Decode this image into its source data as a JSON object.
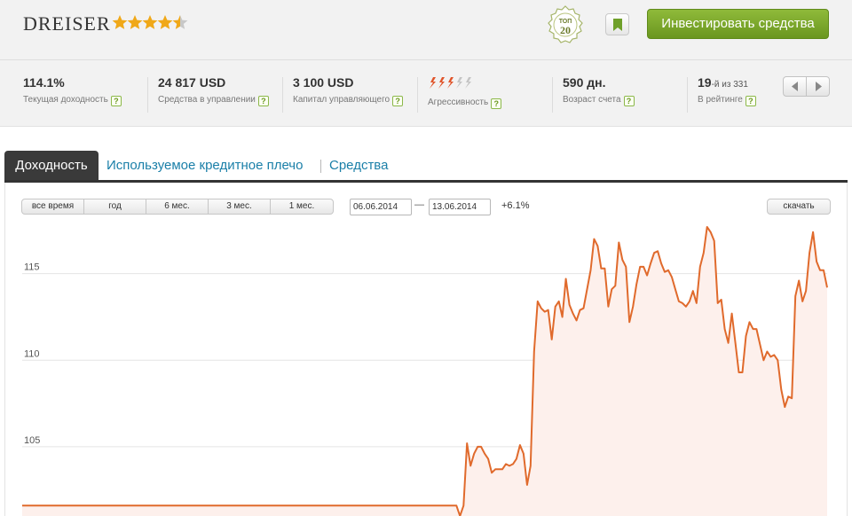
{
  "header": {
    "name": "DREISER",
    "rating_stars": 4.5,
    "badge_top": "ТОП",
    "badge_num": "20",
    "invest_label": "Инвестировать средства"
  },
  "stats": [
    {
      "value": "114.1%",
      "label": "Текущая доходность"
    },
    {
      "value": "24 817 USD",
      "label": "Средства в управлении"
    },
    {
      "value": "3 100 USD",
      "label": "Капитал управляющего"
    },
    {
      "value": "",
      "label": "Агрессивность",
      "aggression_level": 3,
      "aggression_max": 5
    },
    {
      "value": "590 дн.",
      "label": "Возраст счета"
    },
    {
      "value": "19",
      "value_suffix": "-й из 331",
      "label": "В рейтинге"
    }
  ],
  "help_glyph": "?",
  "tabs": [
    {
      "label": "Доходность",
      "active": true
    },
    {
      "label": "Используемое кредитное плечо",
      "active": false
    },
    {
      "label": "Средства",
      "active": false
    }
  ],
  "controls": {
    "ranges": [
      "все время",
      "год",
      "6 мес.",
      "3 мес.",
      "1 мес."
    ],
    "date_from": "06.06.2014",
    "date_to": "13.06.2014",
    "date_sep": "—",
    "change": "+6.1%",
    "download_label": "скачать"
  },
  "colors": {
    "accent_green": "#7aa82b",
    "line": "#e06a2c",
    "area": "#fdf0ec",
    "link": "#1a7fa8"
  },
  "chart_data": {
    "type": "area",
    "y_ticks": [
      105,
      110,
      115
    ],
    "ylim": [
      101,
      117.8
    ],
    "grid": true,
    "values": [
      101.6,
      101.6,
      101.6,
      101.6,
      101.6,
      101.6,
      101.6,
      101.6,
      101.6,
      101.6,
      101.6,
      101.6,
      101.6,
      101.6,
      101.6,
      101.6,
      101.6,
      101.6,
      101.6,
      101.6,
      101.6,
      101.6,
      101.6,
      101.6,
      101.6,
      101.6,
      101.6,
      101.6,
      101.6,
      101.6,
      101.6,
      101.6,
      101.6,
      101.6,
      101.6,
      101.6,
      101.6,
      101.6,
      101.6,
      101.6,
      101.6,
      101.6,
      101.6,
      101.6,
      101.6,
      101.6,
      101.6,
      101.6,
      101.6,
      101.6,
      101.6,
      101.6,
      101.6,
      101.6,
      101.6,
      101.6,
      101.6,
      101.6,
      101.6,
      101.6,
      101.6,
      101.6,
      101.6,
      101.6,
      101.6,
      101.6,
      101.6,
      101.6,
      101.6,
      101.6,
      101.6,
      101.6,
      101.6,
      101.6,
      101.6,
      101.6,
      101.6,
      101.6,
      101.6,
      101.6,
      101.6,
      101.6,
      101.6,
      101.6,
      101.6,
      101.6,
      101.6,
      101.6,
      101.6,
      101.6,
      101.6,
      101.6,
      101.6,
      101.6,
      101.6,
      101.6,
      101.6,
      101.6,
      101.6,
      101.6,
      101.6,
      101.6,
      101.6,
      101.6,
      101.6,
      101.6,
      101.6,
      101.6,
      101.6,
      101.6,
      101.6,
      101.6,
      101.6,
      101.6,
      101.6,
      101.6,
      101.6,
      101.6,
      101.6,
      101.6,
      101.6,
      101.6,
      101.6,
      101.6,
      101.0,
      101.6,
      105.2,
      103.9,
      104.6,
      105.0,
      105.0,
      104.6,
      104.3,
      103.5,
      103.7,
      103.7,
      103.7,
      104.0,
      103.9,
      104.0,
      104.3,
      105.1,
      104.6,
      102.8,
      103.9,
      110.5,
      113.4,
      113.0,
      112.8,
      112.9,
      111.2,
      113.1,
      113.4,
      112.5,
      114.7,
      113.2,
      112.7,
      112.3,
      112.9,
      113.0,
      114.1,
      115.2,
      117.0,
      116.6,
      115.3,
      115.3,
      113.1,
      114.1,
      114.3,
      116.8,
      115.8,
      115.4,
      112.2,
      113.1,
      114.4,
      115.4,
      115.4,
      114.9,
      115.6,
      116.2,
      116.3,
      115.6,
      115.1,
      115.2,
      114.8,
      114.1,
      113.4,
      113.3,
      113.1,
      113.4,
      114.0,
      113.3,
      115.4,
      116.2,
      117.7,
      117.4,
      116.9,
      113.3,
      113.5,
      111.8,
      111.0,
      112.7,
      111.0,
      109.3,
      109.3,
      111.4,
      112.2,
      111.8,
      111.8,
      110.9,
      110.0,
      110.5,
      110.2,
      110.3,
      110.0,
      108.3,
      107.3,
      107.9,
      107.8,
      113.7,
      114.6,
      113.4,
      114.0,
      116.2,
      117.4,
      115.7,
      115.2,
      115.2,
      114.2
    ]
  }
}
